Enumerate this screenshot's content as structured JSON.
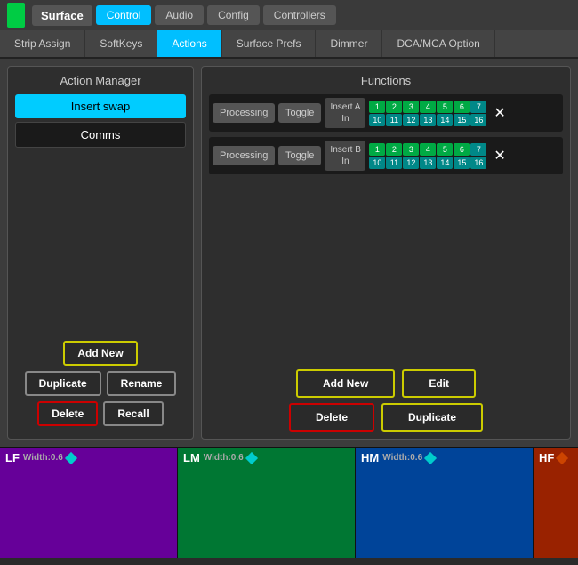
{
  "topbar": {
    "surface_label": "Surface",
    "tabs": [
      {
        "label": "Control",
        "active": true
      },
      {
        "label": "Audio",
        "active": false
      },
      {
        "label": "Config",
        "active": false
      },
      {
        "label": "Controllers",
        "active": false
      }
    ]
  },
  "navtabs": [
    {
      "label": "Strip Assign",
      "active": false
    },
    {
      "label": "SoftKeys",
      "active": false
    },
    {
      "label": "Actions",
      "active": true
    },
    {
      "label": "Surface Prefs",
      "active": false
    },
    {
      "label": "Dimmer",
      "active": false
    },
    {
      "label": "DCA/MCA Option",
      "active": false
    }
  ],
  "left_panel": {
    "title": "Action Manager",
    "actions": [
      {
        "label": "Insert swap",
        "selected": true
      },
      {
        "label": "Comms",
        "selected": false
      }
    ],
    "buttons": {
      "add_new": "Add New",
      "duplicate": "Duplicate",
      "rename": "Rename",
      "delete": "Delete",
      "recall": "Recall"
    }
  },
  "right_panel": {
    "title": "Functions",
    "functions": [
      {
        "tag": "Processing",
        "toggle": "Toggle",
        "insert": "Insert A\nIn",
        "numbers_row1": [
          "1",
          "2",
          "3",
          "4",
          "5",
          "6",
          "7"
        ],
        "numbers_row2": [
          "10",
          "11",
          "12",
          "13",
          "14",
          "15",
          "16"
        ]
      },
      {
        "tag": "Processing",
        "toggle": "Toggle",
        "insert": "Insert B\nIn",
        "numbers_row1": [
          "1",
          "2",
          "3",
          "4",
          "5",
          "6",
          "7"
        ],
        "numbers_row2": [
          "10",
          "11",
          "12",
          "13",
          "14",
          "15",
          "16"
        ]
      }
    ],
    "buttons": {
      "add_new": "Add New",
      "edit": "Edit",
      "delete": "Delete",
      "duplicate": "Duplicate"
    }
  },
  "eq_sections": [
    {
      "label": "LF",
      "width": "Width:0.6",
      "color": "lf"
    },
    {
      "label": "LM",
      "width": "Width:0.6",
      "color": "lm"
    },
    {
      "label": "HM",
      "width": "Width:0.6",
      "color": "hm"
    },
    {
      "label": "HF",
      "width": "",
      "color": "hf"
    }
  ]
}
